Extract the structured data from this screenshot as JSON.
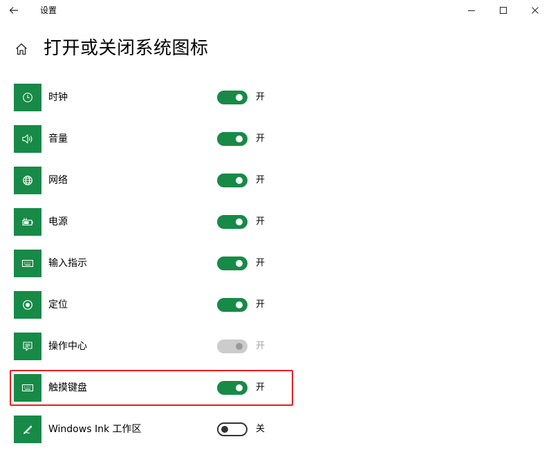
{
  "window": {
    "title": "设置",
    "controls": [
      "minimize",
      "maximize",
      "close"
    ]
  },
  "page": {
    "title": "打开或关闭系统图标"
  },
  "accent_color": "#178a47",
  "items": [
    {
      "label": "时钟",
      "icon": "clock-icon",
      "state": "on",
      "state_label": "开"
    },
    {
      "label": "音量",
      "icon": "volume-icon",
      "state": "on",
      "state_label": "开"
    },
    {
      "label": "网络",
      "icon": "globe-icon",
      "state": "on",
      "state_label": "开"
    },
    {
      "label": "电源",
      "icon": "battery-icon",
      "state": "on",
      "state_label": "开"
    },
    {
      "label": "输入指示",
      "icon": "keyboard-icon",
      "state": "on",
      "state_label": "开"
    },
    {
      "label": "定位",
      "icon": "location-icon",
      "state": "on",
      "state_label": "开"
    },
    {
      "label": "操作中心",
      "icon": "action-center-icon",
      "state": "on-disabled",
      "state_label": "开"
    },
    {
      "label": "触摸键盘",
      "icon": "touch-keyboard-icon",
      "state": "on",
      "state_label": "开",
      "highlighted": true
    },
    {
      "label": "Windows Ink 工作区",
      "icon": "pen-icon",
      "state": "off",
      "state_label": "关"
    }
  ]
}
